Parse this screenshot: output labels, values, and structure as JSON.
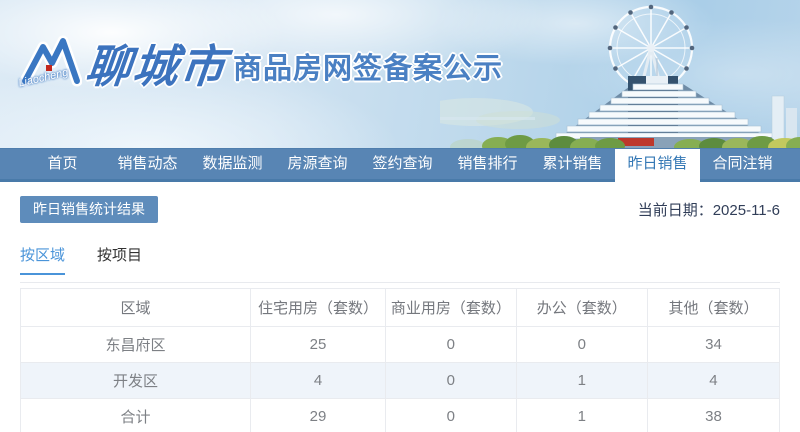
{
  "header": {
    "logo_script": "Liaocheng",
    "city_name": "聊城市",
    "site_title": "商品房网签备案公示"
  },
  "nav": {
    "items": [
      {
        "label": "首页",
        "active": false
      },
      {
        "label": "销售动态",
        "active": false
      },
      {
        "label": "数据监测",
        "active": false
      },
      {
        "label": "房源查询",
        "active": false
      },
      {
        "label": "签约查询",
        "active": false
      },
      {
        "label": "销售排行",
        "active": false
      },
      {
        "label": "累计销售",
        "active": false
      },
      {
        "label": "昨日销售",
        "active": true
      },
      {
        "label": "合同注销",
        "active": false
      }
    ]
  },
  "toolbar": {
    "section_button": "昨日销售统计结果",
    "date_label": "当前日期：",
    "date_value": "2025-11-6"
  },
  "tabs": [
    {
      "label": "按区域",
      "active": true
    },
    {
      "label": "按项目",
      "active": false
    }
  ],
  "table": {
    "columns": [
      "区域",
      "住宅用房（套数）",
      "商业用房（套数）",
      "办公（套数）",
      "其他（套数）"
    ],
    "rows": [
      {
        "region": "东昌府区",
        "values": [
          "25",
          "0",
          "0",
          "34"
        ]
      },
      {
        "region": "开发区",
        "values": [
          "4",
          "0",
          "1",
          "4"
        ]
      },
      {
        "region": "合计",
        "values": [
          "29",
          "0",
          "1",
          "38"
        ]
      }
    ]
  },
  "colors": {
    "nav_background": "#5885b4",
    "nav_active_text": "#3478b5",
    "accent_blue": "#4a94d9",
    "button_background": "#5e8cbb",
    "table_alt_row": "#eff4fa",
    "title_blue": "#4a80c3",
    "date_text": "#313e58"
  }
}
